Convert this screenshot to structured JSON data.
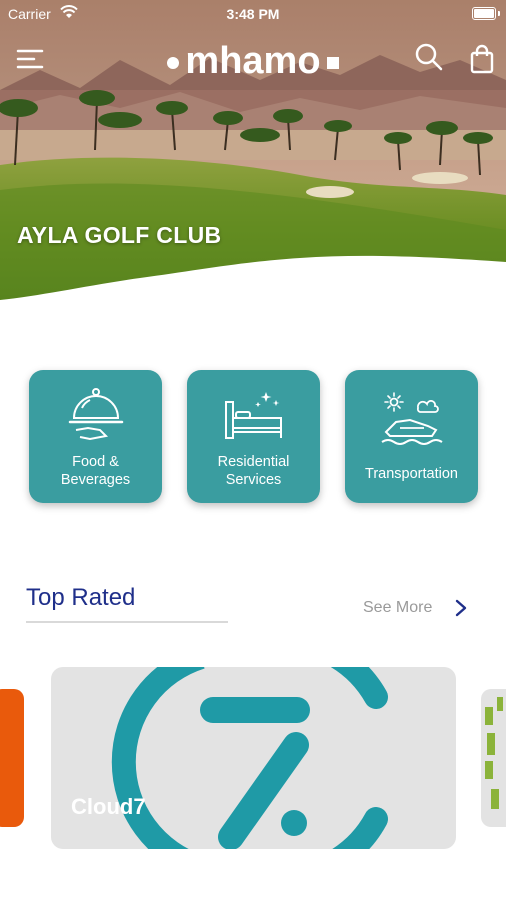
{
  "status_bar": {
    "carrier": "Carrier",
    "time": "3:48 PM"
  },
  "header": {
    "logo": "mhamo"
  },
  "hero": {
    "title": "AYLA GOLF CLUB"
  },
  "categories": [
    {
      "label_line1": "Food &",
      "label_line2": "Beverages",
      "icon": "serving-cloche-icon"
    },
    {
      "label_line1": "Residential",
      "label_line2": "Services",
      "icon": "bed-icon"
    },
    {
      "label": "Transportation",
      "icon": "boat-icon"
    }
  ],
  "top_rated": {
    "title": "Top Rated",
    "see_more": "See More",
    "cards": [
      {
        "name": "Cloud7"
      }
    ]
  },
  "colors": {
    "accent": "#3a9da0",
    "title_blue": "#1f2f8a",
    "cloud7_teal": "#1f9aa6",
    "left_card": "#e95a0c"
  }
}
